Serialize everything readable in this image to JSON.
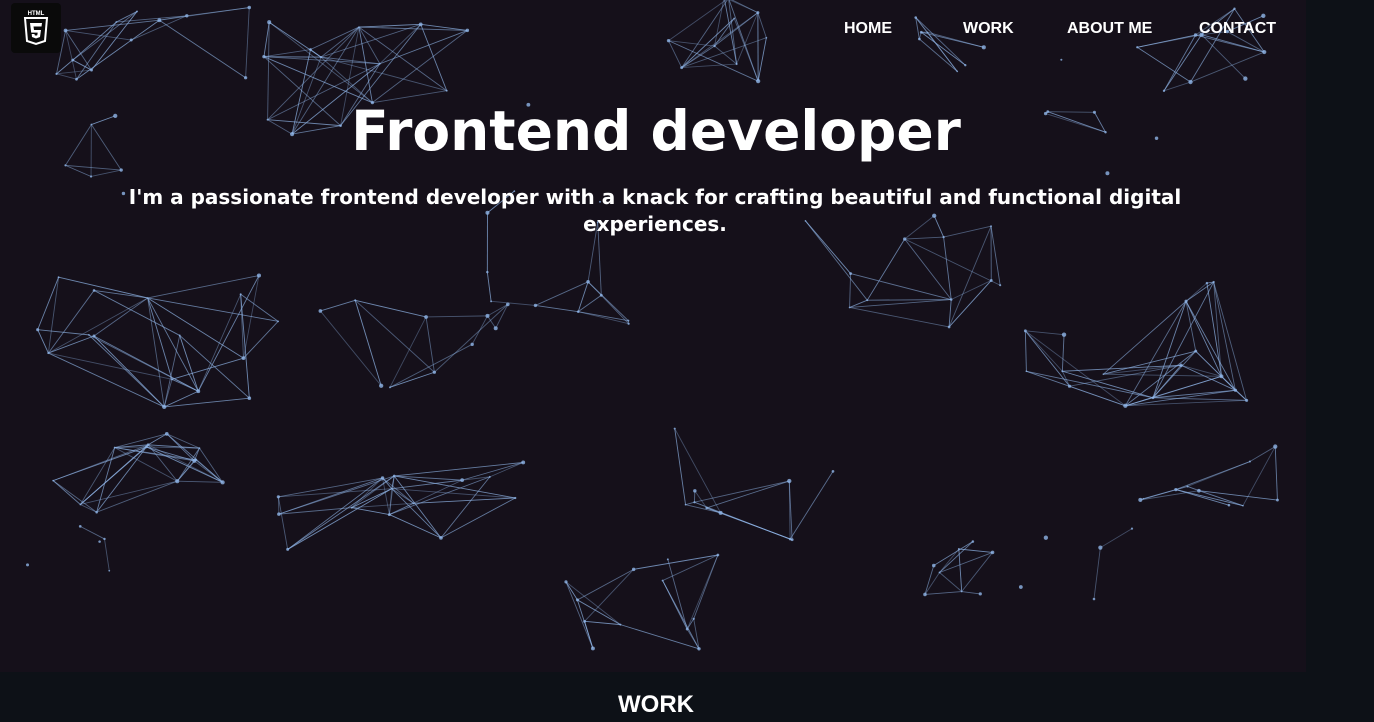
{
  "logo": {
    "icon": "html5-icon",
    "text": "HTML"
  },
  "nav": {
    "items": [
      {
        "label": "HOME"
      },
      {
        "label": "WORK"
      },
      {
        "label": "ABOUT ME"
      },
      {
        "label": "CONTACT"
      }
    ]
  },
  "hero": {
    "title": "Frontend developer",
    "subtitle": "I'm a passionate frontend developer with a knack for crafting beautiful and functional digital experiences."
  },
  "work_section": {
    "title": "WORK"
  },
  "colors": {
    "page_bg": "#0d1117",
    "hero_bg": "#15101a",
    "network_lines": "#8fb4e6",
    "text": "#ffffff"
  }
}
